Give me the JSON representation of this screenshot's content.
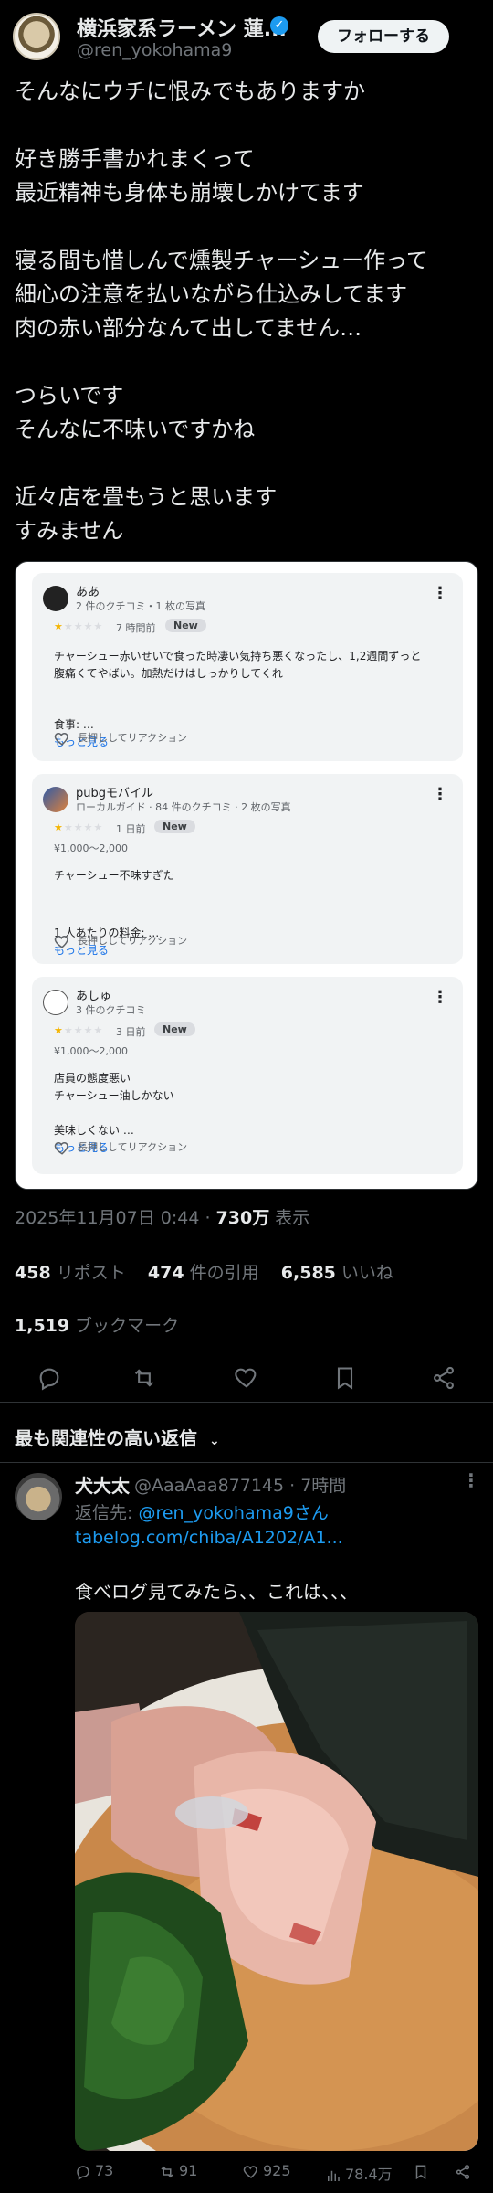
{
  "author": {
    "name": "横浜家系ラーメン 蓮...",
    "handle": "@ren_yokohama9",
    "follow_label": "フォローする"
  },
  "tweet": {
    "paragraphs": [
      "そんなにウチに恨みでもありますか",
      "好き勝手書かれまくって\n最近精神も身体も崩壊しかけてます",
      "寝る間も惜しんで燻製チャーシュー作って\n細心の注意を払いながら仕込みしてます\n肉の赤い部分なんて出してません…",
      "つらいです\nそんなに不味いですかね",
      "近々店を畳もうと思います\nすみません"
    ]
  },
  "reviews": [
    {
      "name": "ああ",
      "meta": "2 件のクチコミ・1 枚の写真",
      "time": "7 時間前",
      "badge": "New",
      "price": "",
      "body": "チャーシュー赤いせいで食った時凄い気持ち悪くなったし、1,2週間ずっと\n腹痛くてやばい。加熱だけはしっかりしてくれ",
      "extra_label": "食事: …",
      "more": "もっと見る",
      "react": "長押ししてリアクション",
      "rating": 1
    },
    {
      "name": "pubgモバイル",
      "meta": "ローカルガイド · 84 件のクチコミ · 2 枚の写真",
      "time": "1 日前",
      "badge": "New",
      "price": "¥1,000～2,000",
      "body": "チャーシュー不味すぎた",
      "extra_label": "1 人あたりの料金: …",
      "more": "もっと見る",
      "react": "長押ししてリアクション",
      "rating": 1
    },
    {
      "name": "あしゅ",
      "meta": "3 件のクチコミ",
      "time": "3 日前",
      "badge": "New",
      "price": "¥1,000～2,000",
      "body": "店員の態度悪い\nチャーシュー油しかない",
      "extra_label": "美味しくない …",
      "more": "もっと見る",
      "react": "長押ししてリアクション",
      "rating": 1
    }
  ],
  "meta": {
    "datetime": "2025年11月07日 0:44 · ",
    "views": "730万",
    "views_label": " 表示"
  },
  "stats": {
    "reposts": "458",
    "reposts_label": " リポスト",
    "quotes": "474",
    "quotes_label": " 件の引用",
    "likes": "6,585",
    "likes_label": " いいね",
    "bookmarks": "1,519",
    "bookmarks_label": " ブックマーク"
  },
  "sort_label": "最も関連性の高い返信",
  "reply": {
    "name": "犬大太",
    "handle": "@AaaAaa877145 · 7時間",
    "reply_to_label": "返信先: ",
    "reply_to_handle": "@ren_yokohama9さん",
    "link": "tabelog.com/chiba/A1202/A1...",
    "text": "食べログ見てみたら、、これは、、、",
    "replies": "73",
    "reposts": "91",
    "likes": "925",
    "views": "78.4万"
  },
  "colors": {
    "background": "#000000",
    "text": "#e7e9ea",
    "muted": "#71767b",
    "accent": "#1d9bf0",
    "divider": "#2f3336"
  }
}
